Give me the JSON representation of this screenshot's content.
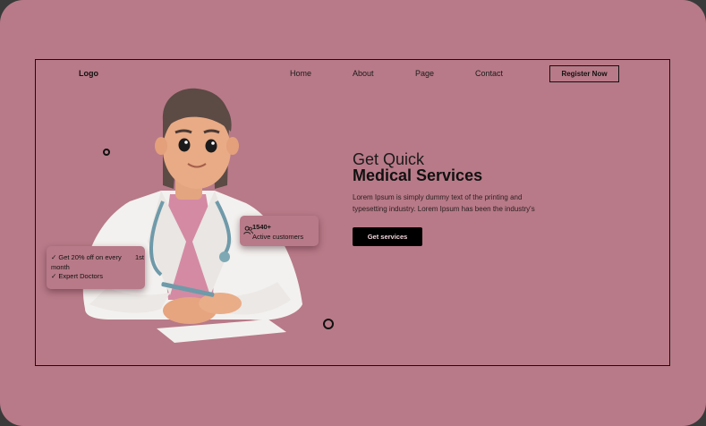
{
  "header": {
    "logo": "Logo",
    "nav": [
      "Home",
      "About",
      "Page",
      "Contact"
    ],
    "register_label": "Register Now"
  },
  "hero": {
    "title_line1": "Get Quick",
    "title_line2": "Medical Services",
    "description_line1": "Lorem Ipsum is simply dummy text of the printing and",
    "description_line2": "typesetting industry. Lorem Ipsum has been the industry's",
    "cta_label": "Get services"
  },
  "badges": {
    "customers": {
      "count": "1540+",
      "label": "Active customers",
      "icon": "users-icon"
    },
    "offer": {
      "line1": "✓ Get 20% off on every",
      "line1_suffix": "1st",
      "line2": "month",
      "line3": "✓ Expert Doctors"
    }
  },
  "colors": {
    "background": "#b87a88",
    "cta_bg": "#000000",
    "outer": "#3a3a3a"
  }
}
